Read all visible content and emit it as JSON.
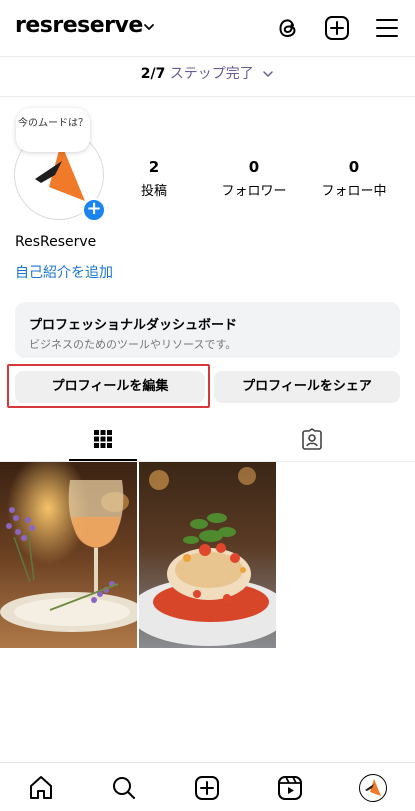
{
  "header": {
    "username": "resreserve",
    "icons": [
      "chevron-down-icon",
      "threads-icon",
      "plus-square-icon",
      "menu-icon"
    ]
  },
  "steps": {
    "count": "2/7",
    "label": "ステップ完了"
  },
  "profile": {
    "mood_bubble": "今のムードは？",
    "display_name": "ResReserve",
    "bio_link": "自己紹介を追加",
    "stats": {
      "posts": {
        "value": "2",
        "label": "投稿"
      },
      "followers": {
        "value": "0",
        "label": "フォロワー"
      },
      "following": {
        "value": "0",
        "label": "フォロー中"
      }
    }
  },
  "dashboard": {
    "title": "プロフェッショナルダッシュボード",
    "subtitle": "ビジネスのためのツールやリソースです。"
  },
  "buttons": {
    "edit_profile": "プロフィールを編集",
    "share_profile": "プロフィールをシェア"
  },
  "colors": {
    "link_blue": "#1976d2",
    "step_purple": "#6b5b94",
    "highlight_red": "#d9383a",
    "logo_orange": "#f07a2a"
  },
  "bottom_nav": [
    "home-icon",
    "search-icon",
    "create-icon",
    "reels-icon",
    "profile-avatar"
  ]
}
